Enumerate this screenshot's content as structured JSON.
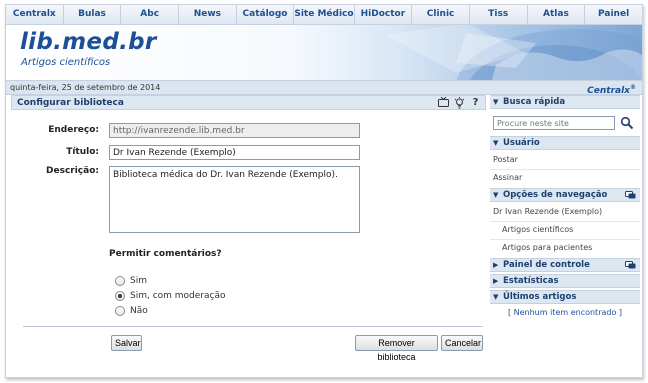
{
  "topnav": [
    "Centralx",
    "Bulas",
    "Abc",
    "News",
    "Catálogo",
    "Site Médico",
    "HiDoctor",
    "Clinic",
    "Tiss",
    "Atlas",
    "Painel"
  ],
  "banner": {
    "site": "lib.med.br",
    "tagline": "Artigos científicos"
  },
  "datebar": {
    "date": "quinta-feira, 25 de setembro de 2014",
    "brand": "Centralx"
  },
  "panel": {
    "title": "Configurar biblioteca",
    "icons": [
      "tv-icon",
      "lightbulb-icon",
      "help-icon"
    ]
  },
  "form": {
    "address_label": "Endereço:",
    "address_value": "http://ivanrezende.lib.med.br",
    "title_label": "Título:",
    "title_value": "Dr Ivan Rezende (Exemplo)",
    "description_label": "Descrição:",
    "description_value": "Biblioteca médica do Dr. Ivan Rezende (Exemplo).",
    "comments_heading": "Permitir comentários?",
    "options": [
      {
        "label": "Sim",
        "selected": false
      },
      {
        "label": "Sim, com moderação",
        "selected": true
      },
      {
        "label": "Não",
        "selected": false
      }
    ]
  },
  "buttons": {
    "save": "Salvar",
    "remove": "Remover biblioteca",
    "cancel": "Cancelar"
  },
  "sidebar": {
    "quick_search": {
      "title": "Busca rápida",
      "placeholder": "Procure neste site"
    },
    "user": {
      "title": "Usuário",
      "items": [
        "Postar",
        "Assinar"
      ]
    },
    "nav": {
      "title": "Opções de navegação",
      "items": [
        "Dr Ivan Rezende (Exemplo)"
      ],
      "subitems": [
        "Artigos científicos",
        "Artigos para pacientes"
      ]
    },
    "control": {
      "title": "Painel de controle"
    },
    "stats": {
      "title": "Estatísticas"
    },
    "latest": {
      "title": "Últimos artigos",
      "empty": "[ Nenhum item encontrado ]"
    }
  }
}
